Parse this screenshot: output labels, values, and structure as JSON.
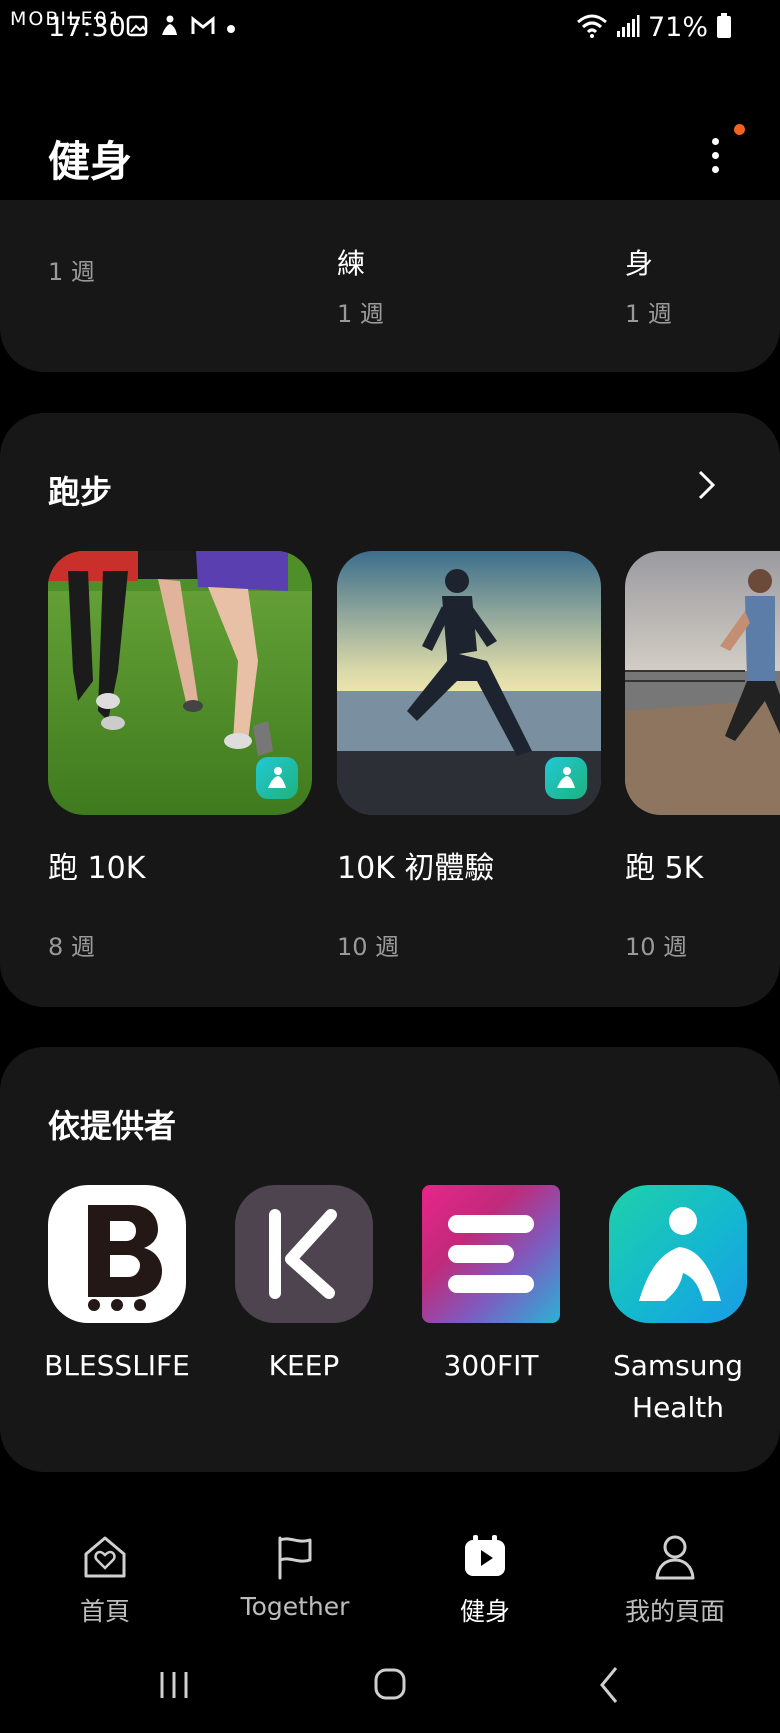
{
  "status_bar": {
    "watermark": "MOBILE01",
    "time": "17:30",
    "battery": "71%"
  },
  "header": {
    "title": "健身"
  },
  "top_card": {
    "items": [
      {
        "title": "",
        "weeks": "1 週"
      },
      {
        "title": "練",
        "weeks": "1 週"
      },
      {
        "title": "身",
        "weeks": "1 週"
      }
    ]
  },
  "running": {
    "title": "跑步",
    "programs": [
      {
        "name": "跑 10K",
        "weeks": "8 週"
      },
      {
        "name": "10K 初體驗",
        "weeks": "10 週"
      },
      {
        "name": "跑 5K",
        "weeks": "10 週"
      }
    ]
  },
  "providers": {
    "title": "依提供者",
    "items": [
      {
        "name": "BLESSLIFE"
      },
      {
        "name": "KEEP"
      },
      {
        "name": "300FIT"
      },
      {
        "name": "Samsung Health"
      }
    ]
  },
  "bottom_nav": {
    "items": [
      {
        "label": "首頁",
        "icon": "home-heart-icon"
      },
      {
        "label": "Together",
        "icon": "flag-icon"
      },
      {
        "label": "健身",
        "icon": "fitness-play-icon",
        "active": true
      },
      {
        "label": "我的頁面",
        "icon": "person-icon"
      }
    ]
  },
  "colors": {
    "background": "#000000",
    "card": "#171717",
    "accent_dot": "#f26322",
    "muted_text": "#9a9a9a"
  }
}
